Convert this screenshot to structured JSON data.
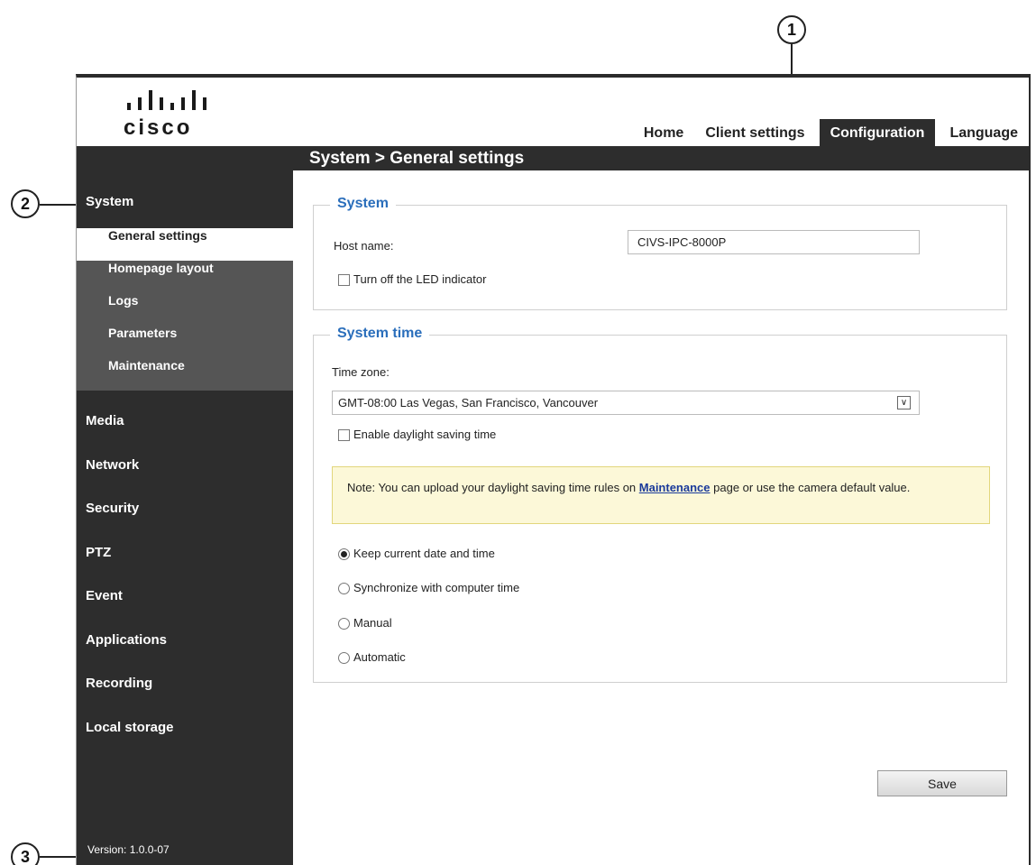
{
  "callouts": [
    "1",
    "2",
    "3"
  ],
  "brand": {
    "logo_text": "cisco",
    "color": "#1a1a1a"
  },
  "topnav": {
    "tabs": [
      "Home",
      "Client settings",
      "Configuration",
      "Language"
    ],
    "active": "Configuration"
  },
  "page_title": "System > General settings",
  "sidebar": {
    "system": {
      "label": "System",
      "items": [
        "General settings",
        "Homepage layout",
        "Logs",
        "Parameters",
        "Maintenance"
      ],
      "active": "General settings"
    },
    "sections": [
      "Media",
      "Network",
      "Security",
      "PTZ",
      "Event",
      "Applications",
      "Recording",
      "Local storage"
    ],
    "version": "Version: 1.0.0-07"
  },
  "system_group": {
    "legend": "System",
    "host_name_label": "Host name:",
    "host_name_value": "CIVS-IPC-8000P",
    "led_label": "Turn off the LED indicator",
    "led_checked": false
  },
  "time_group": {
    "legend": "System time",
    "time_zone_label": "Time zone:",
    "time_zone_value": "GMT-08:00 Las Vegas, San Francisco, Vancouver",
    "dst_label": "Enable daylight saving time",
    "dst_checked": false,
    "note_prefix": "Note: You can upload your daylight saving time rules on ",
    "note_link": "Maintenance",
    "note_suffix": " page or use the camera default value.",
    "options": [
      "Keep current date and time",
      "Synchronize with computer time",
      "Manual",
      "Automatic"
    ],
    "selected_option": "Keep current date and time"
  },
  "save_label": "Save",
  "colors": {
    "dark": "#2d2d2d",
    "submenu": "#555555",
    "legend": "#2a6ebb",
    "note_bg": "#fcf8d8"
  }
}
